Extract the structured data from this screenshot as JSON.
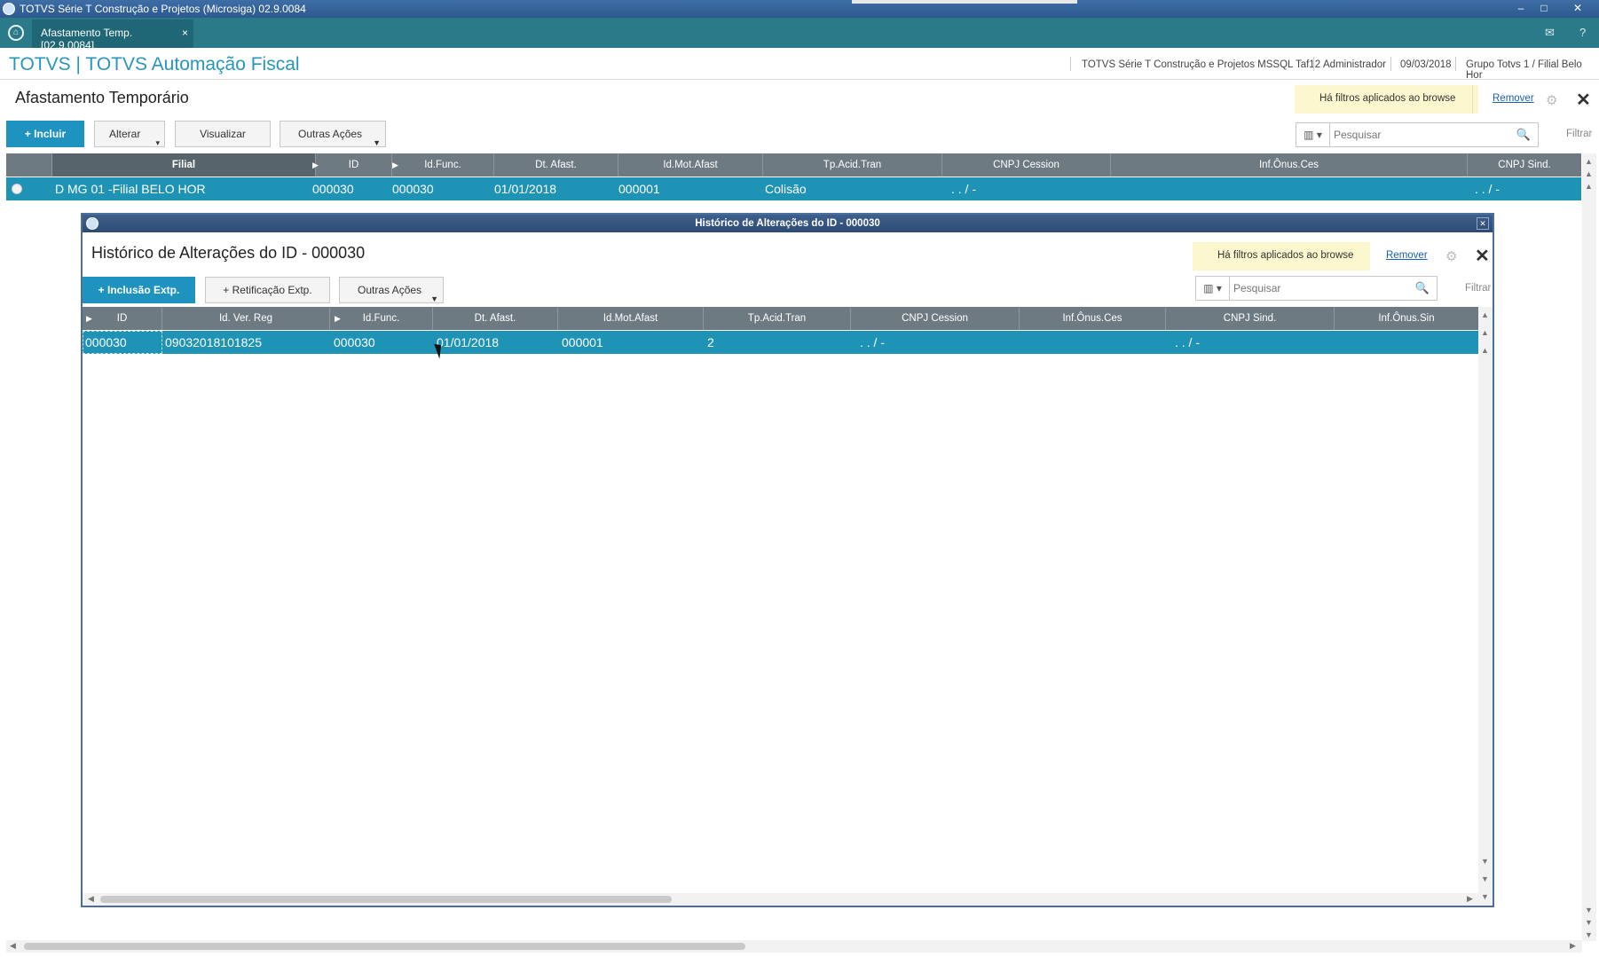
{
  "window": {
    "title": "TOTVS Série T Construção e Projetos (Microsiga) 02.9.0084",
    "min": "–",
    "max": "□",
    "close": "✕"
  },
  "tabs": {
    "home_icon": "⌂",
    "active_label": "Afastamento Temp. [02.9.0084]",
    "close": "×",
    "mail_icon": "✉",
    "help_icon": "?"
  },
  "brandbar": {
    "brand": "TOTVS | TOTVS Automação Fiscal",
    "environment": "TOTVS Série T Construção e Projetos MSSQL Taf12",
    "user": "Administrador",
    "date": "09/03/2018",
    "branch": "Grupo Totvs 1 / Filial Belo Hor"
  },
  "main": {
    "title": "Afastamento Temporário",
    "filter_notice": "Há filtros aplicados ao browse",
    "remove_label": "Remover",
    "buttons": {
      "include": "+ Incluir",
      "alter": "Alterar",
      "view": "Visualizar",
      "other": "Outras Ações"
    },
    "search_placeholder": "Pesquisar",
    "filter_label": "Filtrar",
    "columns": [
      "Filial",
      "ID",
      "Id.Func.",
      "Dt. Afast.",
      "Id.Mot.Afast",
      "Tp.Acid.Tran",
      "CNPJ Cession",
      "Inf.Ônus.Ces",
      "CNPJ Sind."
    ],
    "row": {
      "filial": "D MG 01 -Filial BELO HOR",
      "id": "000030",
      "id_func": "000030",
      "dt_afast": "01/01/2018",
      "id_mot": "000001",
      "tp_acid": "Colisão",
      "cnpj_cession": ". . /  -",
      "cnpj_sind": ". . /  -"
    }
  },
  "dialog": {
    "window_title": "Histórico de Alterações do ID - 000030",
    "title": "Histórico de Alterações do ID - 000030",
    "filter_notice": "Há filtros aplicados ao browse",
    "remove_label": "Remover",
    "buttons": {
      "include_ext": "+ Inclusão Extp.",
      "rectify_ext": "+ Retificação Extp.",
      "other": "Outras Ações"
    },
    "search_placeholder": "Pesquisar",
    "filter_label": "Filtrar",
    "columns": [
      "ID",
      "Id. Ver. Reg",
      "Id.Func.",
      "Dt. Afast.",
      "Id.Mot.Afast",
      "Tp.Acid.Tran",
      "CNPJ Cession",
      "Inf.Ônus.Ces",
      "CNPJ Sind.",
      "Inf.Ônus.Sin"
    ],
    "row": {
      "id": "000030",
      "id_ver_reg": "09032018101825",
      "id_func": "000030",
      "dt_afast": "01/01/2018",
      "id_mot": "000001",
      "tp_acid": "2",
      "cnpj_cession": ". . /  -",
      "cnpj_sind": ". . /  -"
    }
  }
}
